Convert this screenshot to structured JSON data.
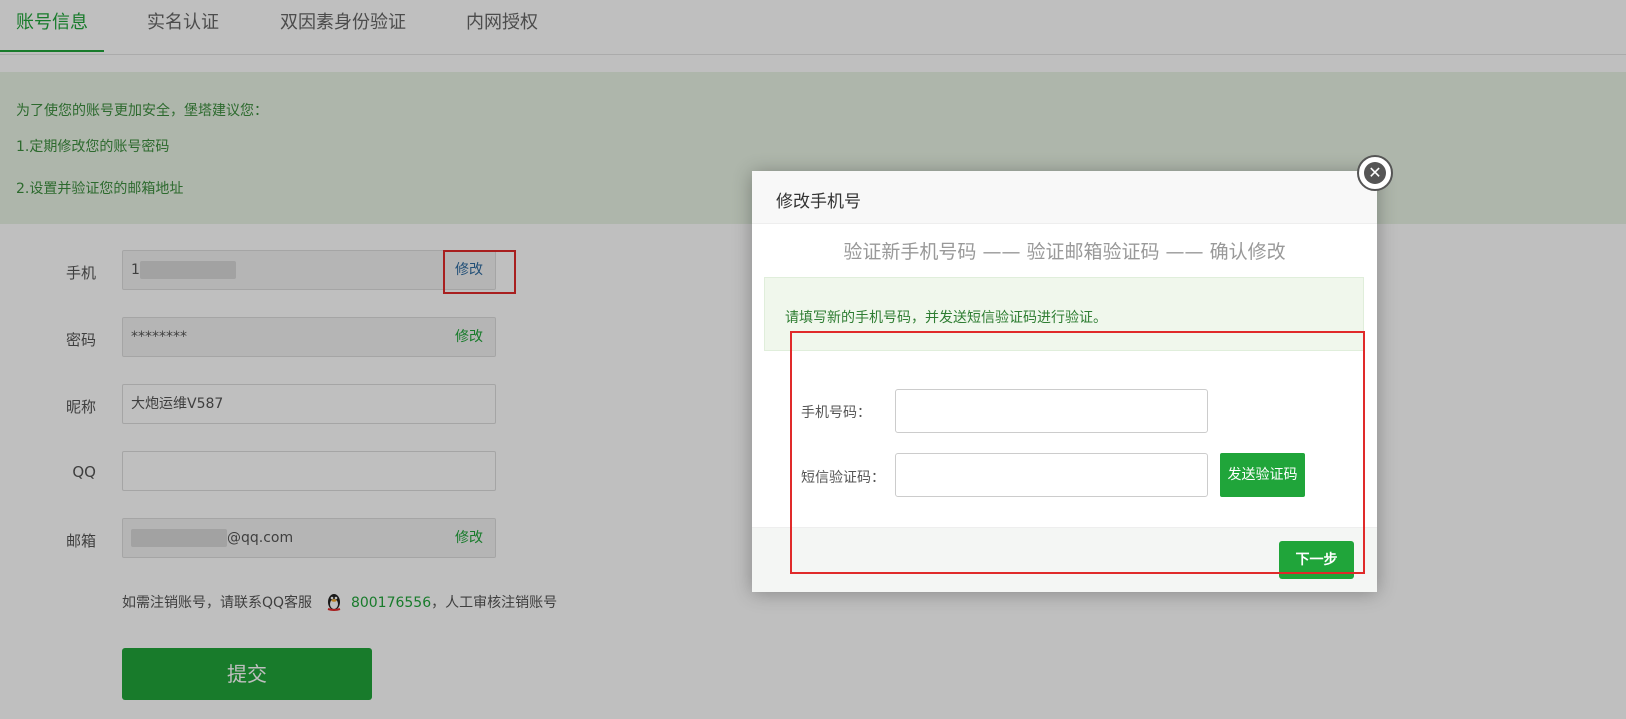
{
  "tabs": [
    "账号信息",
    "实名认证",
    "双因素身份验证",
    "内网授权"
  ],
  "notice": {
    "line1": "为了使您的账号更加安全，堡塔建议您：",
    "line2": "1.定期修改您的账号密码",
    "line3": "2.设置并验证您的邮箱地址"
  },
  "form": {
    "phone_label": "手机",
    "phone_value_visible": "1",
    "phone_edit": "修改",
    "password_label": "密码",
    "password_value": "********",
    "password_edit": "修改",
    "nickname_label": "昵称",
    "nickname_value": "大炮运维V587",
    "qq_label": "QQ",
    "qq_value": "",
    "email_label": "邮箱",
    "email_value_visible": "@qq.com",
    "email_edit": "修改"
  },
  "qq_note": {
    "prefix": "如需注销账号，请联系QQ客服",
    "number": "800176556",
    "suffix": "，人工审核注销账号"
  },
  "submit_label": "提交",
  "modal": {
    "title": "修改手机号",
    "steps": "验证新手机号码 —— 验证邮箱验证码 —— 确认修改",
    "alert": "请填写新的手机号码，并发送短信验证码进行验证。",
    "phone_label": "手机号码：",
    "phone_value": "",
    "code_label": "短信验证码：",
    "code_value": "",
    "send_code": "发送验证码",
    "next": "下一步",
    "close": "✕"
  },
  "colors": {
    "brand_green": "#20a53a",
    "highlight_red": "#e02a2a"
  }
}
